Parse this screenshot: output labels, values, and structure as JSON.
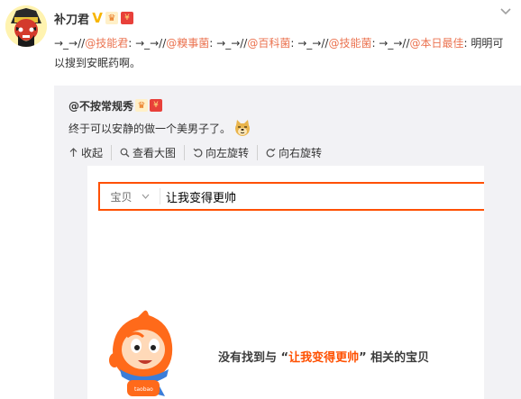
{
  "post": {
    "author": "补刀君",
    "text_segments": [
      {
        "text": "→_→//",
        "type": "plain"
      },
      {
        "text": "@技能君",
        "type": "link"
      },
      {
        "text": ": →_→//",
        "type": "plain"
      },
      {
        "text": "@糗事菌",
        "type": "link"
      },
      {
        "text": ": →_→//",
        "type": "plain"
      },
      {
        "text": "@百科菌",
        "type": "link"
      },
      {
        "text": ": →_→//",
        "type": "plain"
      },
      {
        "text": "@技能菌",
        "type": "link"
      },
      {
        "text": ": →_→//",
        "type": "plain"
      },
      {
        "text": "@本日最佳",
        "type": "link"
      },
      {
        "text": ": 明明可以搜到安眠药啊。",
        "type": "plain"
      }
    ]
  },
  "repost": {
    "author": "@不按常规秀",
    "text": "终于可以安静的做一个美男子了。",
    "toolbar": {
      "collapse": "收起",
      "view_large": "查看大图",
      "rotate_left": "向左旋转",
      "rotate_right": "向右旋转"
    }
  },
  "screenshot": {
    "search_category": "宝贝",
    "search_query": "让我变得更帅",
    "no_result_prefix": "没有找到与 “",
    "no_result_query": "让我变得更帅",
    "no_result_suffix": "” 相关的宝贝"
  },
  "colors": {
    "link": "#eb7350",
    "taobao_orange": "#ff5000",
    "repost_bg": "#f2f2f5"
  },
  "icons": [
    "avatar",
    "verified-v-icon",
    "crown-badge-icon",
    "red-envelope-icon",
    "chevron-down-icon",
    "doge-emoji-icon",
    "collapse-arrow-icon",
    "zoom-icon",
    "rotate-left-icon",
    "rotate-right-icon",
    "dropdown-caret-icon",
    "taobao-mascot-icon"
  ]
}
